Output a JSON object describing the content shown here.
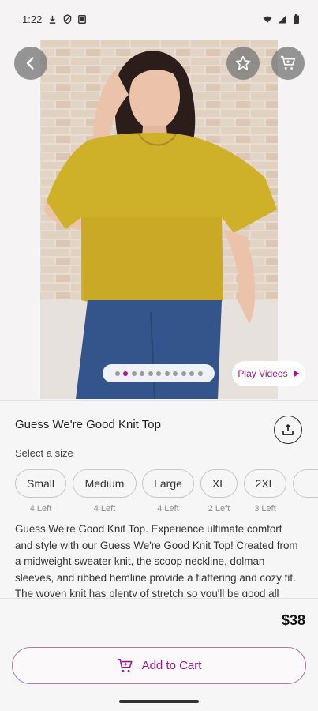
{
  "status_bar": {
    "time": "1:22",
    "icons": [
      "download-icon",
      "shield-icon",
      "notification-icon",
      "wifi-icon",
      "signal-icon",
      "battery-icon"
    ]
  },
  "header": {
    "back_icon": "arrow-left-icon",
    "favorite_icon": "star-icon",
    "cart_icon": "cart-icon"
  },
  "gallery": {
    "image_count": 11,
    "active_index": 1,
    "play_videos_label": "Play Videos",
    "accent_color": "#a0158f"
  },
  "product": {
    "title": "Guess We're Good Knit Top",
    "size_label": "Select a size",
    "sizes": [
      {
        "label": "Small",
        "stock": "4 Left"
      },
      {
        "label": "Medium",
        "stock": "4 Left"
      },
      {
        "label": "Large",
        "stock": "4 Left"
      },
      {
        "label": "XL",
        "stock": "2 Left"
      },
      {
        "label": "2XL",
        "stock": "3 Left"
      }
    ],
    "description": "Guess We're Good Knit Top. Experience ultimate comfort and style with our Guess We're Good Knit Top! Created from a midweight sweater knit, the scoop neckline, dolman sleeves, and ribbed hemline provide a flattering and cozy fit. The woven knit has plenty of stretch so you'll be good all",
    "price": "$38"
  },
  "actions": {
    "add_to_cart_label": "Add to Cart"
  }
}
